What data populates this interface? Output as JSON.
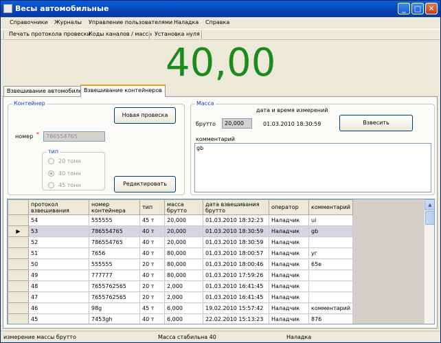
{
  "window": {
    "title": "Весы автомобильные",
    "min_glyph": "_",
    "max_glyph": "□",
    "close_glyph": "✕"
  },
  "menu": [
    "Справочники",
    "Журналы",
    "Управление пользователями",
    "Наладка",
    "Справка"
  ],
  "toolbar": [
    "Печать протокола провески",
    "Коды каналов / масса",
    "Установка нуля"
  ],
  "weight_display": "40,00",
  "tabs": [
    "Взвешивание автомобилей",
    "Взвешивание контейнеров"
  ],
  "active_tab": 1,
  "container_group": {
    "legend": "Контейнер",
    "new_weighing_button": "Новая провеска",
    "number_label": "номер",
    "required_mark": "*",
    "number_value": "786554765",
    "type_legend": "тип",
    "type_options": [
      "20 тонн",
      "40 тонн",
      "45 тонн"
    ],
    "type_selected": 1,
    "edit_button": "Редактировать"
  },
  "mass_group": {
    "legend": "Масса",
    "datetime_label": "дата и время измерений",
    "gross_label": "брутто",
    "gross_value": "20,000",
    "datetime_value": "01.03.2010 18:30:59",
    "weigh_button": "Взвесить",
    "comment_label": "комментарий",
    "comment_value": "gb"
  },
  "grid": {
    "columns": [
      "протокол взвешивания",
      "номер контейнера",
      "тип",
      "масса брутто",
      "дата взвешивания брутто",
      "оператор",
      "комментарий"
    ],
    "selected_row": 1,
    "current_row_marker": "▶",
    "rows": [
      [
        "54",
        "555555",
        "45 т",
        "20,000",
        "01.03.2010 18:32:23",
        "Наладчик",
        "ui"
      ],
      [
        "53",
        "786554765",
        "40 т",
        "20,000",
        "01.03.2010 18:30:59",
        "Наладчик",
        "gb"
      ],
      [
        "52",
        "786554765",
        "40 т",
        "20,000",
        "01.03.2010 18:30:59",
        "Наладчик",
        ""
      ],
      [
        "51",
        "7656",
        "40 т",
        "80,000",
        "01.03.2010 18:00:57",
        "Наладчик",
        "уг"
      ],
      [
        "50",
        "555555",
        "20 т",
        "80,000",
        "01.03.2010 18:00:46",
        "Наладчик",
        "65е"
      ],
      [
        "49",
        "777777",
        "40 т",
        "80,000",
        "01.03.2010 17:59:26",
        "Наладчик",
        ""
      ],
      [
        "48",
        "7655762565",
        "20 т",
        "2,000",
        "01.03.2010 16:41:45",
        "Наладчик",
        ""
      ],
      [
        "47",
        "7655762565",
        "20 т",
        "2,000",
        "01.03.2010 16:41:45",
        "Наладчик",
        ""
      ],
      [
        "46",
        "98g",
        "45 т",
        "6,000",
        "19.02.2010 15:57:42",
        "Наладчик",
        "комментарий"
      ],
      [
        "45",
        "7453gh",
        "40 т",
        "6,000",
        "22.02.2010 15:13:23",
        "Наладчик",
        "876"
      ]
    ],
    "scroll_up_glyph": "▲"
  },
  "status": [
    "измерение массы брутто",
    "Масса стабильна 40",
    "Наладка"
  ]
}
